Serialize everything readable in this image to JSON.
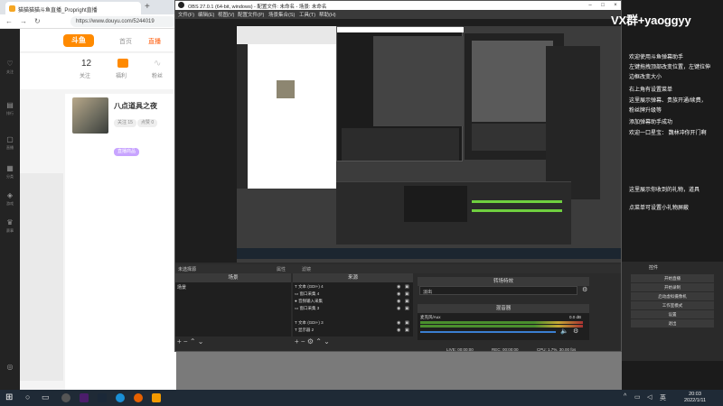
{
  "browser": {
    "tab_title": "猫猫猫猫斗鱼直播_Propright直播",
    "new_tab": "+",
    "url": "https://www.douyu.com/5244019",
    "back": "←",
    "forward": "→",
    "refresh": "↻"
  },
  "douyu": {
    "logo": "斗鱼",
    "nav": [
      "首页",
      "直播"
    ],
    "sidebar_labels": [
      "关注",
      "排行",
      "直播",
      "分类",
      "游戏",
      "赛事"
    ],
    "stats": [
      {
        "value": "12",
        "label": "关注"
      },
      {
        "value": "",
        "label": "福利"
      },
      {
        "value": "",
        "label": "粉丝"
      }
    ],
    "card": {
      "name": "八点道具之夜",
      "pill1": "关注 15",
      "pill2": "点赞 0",
      "pill3": "直播商品"
    }
  },
  "obs": {
    "title": "OBS 27.0.1 (64-bit, windows) - 配置文件: 未命名 - 场景: 未命名",
    "menu": [
      "文件(F)",
      "编辑(E)",
      "视图(V)",
      "配置文件(P)",
      "场景集合(S)",
      "工具(T)",
      "帮助(H)"
    ],
    "no_source": "未选择源",
    "properties": "属性",
    "filters": "滤镜",
    "docks": {
      "scenes": {
        "title": "场景",
        "items": [
          "场景"
        ]
      },
      "sources": {
        "title": "来源",
        "items": [
          {
            "icon": "T",
            "label": "文本 (GDI+) 4"
          },
          {
            "icon": "▭",
            "label": "窗口采集 4"
          },
          {
            "icon": "●",
            "label": "音频输入采集"
          },
          {
            "icon": "▭",
            "label": "窗口采集 3"
          },
          {
            "icon": "T",
            "label": "文本 (GDI+) 3"
          },
          {
            "icon": "T",
            "label": "显示器 2"
          }
        ]
      },
      "transition": {
        "title": "转场特效",
        "value": "淡出"
      },
      "mixer": {
        "title": "混音器",
        "channel": "麦克风/Aux",
        "db": "0.0 dB"
      },
      "controls": {
        "title": "控件",
        "buttons": [
          "开始直播",
          "开始录制",
          "启动虚拟摄像机",
          "工作室模式",
          "设置",
          "退出"
        ]
      }
    },
    "status": {
      "live": "LIVE: 00:00:00",
      "rec": "REC: 00:00:00",
      "cpu": "CPU: 1.7%, 30.00 fps"
    }
  },
  "overlay": {
    "vx": "VX群+yaoggyy",
    "lines": [
      "欢迎使用斗鱼弹幕助手",
      "左键拖拽顶部改变位置，左键拉伸",
      "边框改变大小",
      "右上角有设置菜单",
      "这里展示弹幕、贵族开通/续费，",
      "粉丝牌升级等",
      "添加弹幕助手成功",
      "欢迎一口星宝：  魏林冲你开门啊",
      "这里展示你收到的礼物，道具",
      "点菜单可设置小礼物屏蔽"
    ]
  },
  "taskbar": {
    "time": "20:03",
    "date": "2022/1/11"
  },
  "colors": {
    "accent": "#ff8a00",
    "obs_bg": "#2b2b2b",
    "dark_panel": "#1f1f1f",
    "taskbar": "#1f2a36"
  }
}
